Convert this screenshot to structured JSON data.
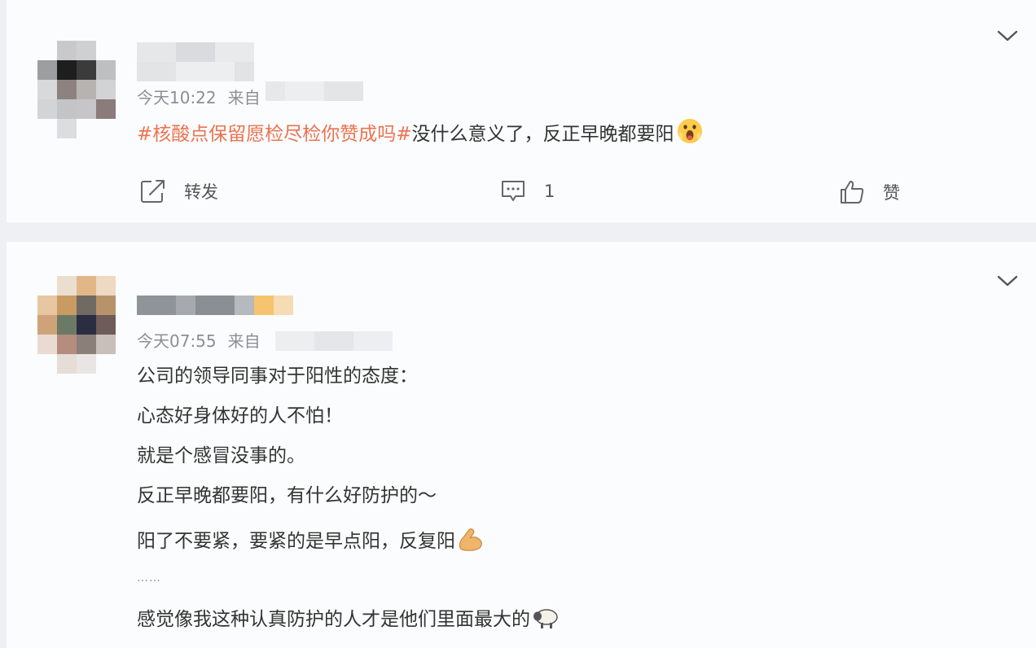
{
  "posts": [
    {
      "time": "今天10:22",
      "source_prefix": "来自",
      "hashtag": "#核酸点保留愿检尽检你赞成吗#",
      "body": "没什么意义了，反正早晚都要阳",
      "body_emoji": "scream-emoji",
      "actions": {
        "repost_label": "转发",
        "comment_count": "1",
        "like_label": "赞"
      }
    },
    {
      "time": "今天07:55",
      "source_prefix": "来自",
      "lines": [
        "公司的领导同事对于阳性的态度：",
        "心态好身体好的人不怕！",
        "就是个感冒没事的。",
        "反正早晚都要阳，有什么好防护的～",
        "阳了不要紧，要紧的是早点阳，反复阳",
        "……",
        "感觉像我这种认真防护的人才是他们里面最大的"
      ],
      "line5_emoji": "flexed-biceps-emoji",
      "line7_emoji": "sheep-emoji"
    }
  ],
  "colors": {
    "hashtag": "#eb7350",
    "meta_text": "#8a8f97",
    "body_text": "#333333",
    "background": "#eef0f3",
    "card": "#fbfcfd"
  }
}
